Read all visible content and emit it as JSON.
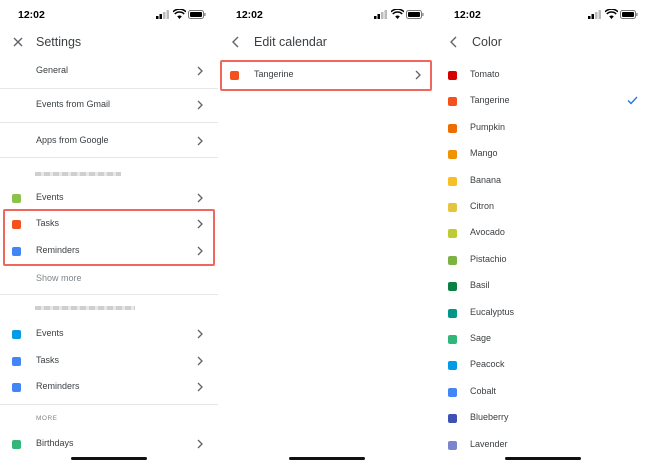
{
  "status_bar": {
    "time": "12:02"
  },
  "settings": {
    "title": "Settings",
    "top_items": [
      {
        "label": "General"
      },
      {
        "label": "Events from Gmail"
      },
      {
        "label": "Apps from Google"
      }
    ],
    "account1_items": [
      {
        "label": "Events",
        "color": "#8bc34a"
      },
      {
        "label": "Tasks",
        "color": "#f4511e"
      },
      {
        "label": "Reminders",
        "color": "#4285f4"
      }
    ],
    "show_more": "Show more",
    "account2_items": [
      {
        "label": "Events",
        "color": "#039be5"
      },
      {
        "label": "Tasks",
        "color": "#4285f4"
      },
      {
        "label": "Reminders",
        "color": "#4285f4"
      }
    ],
    "more_header": "MORE",
    "more_items": [
      {
        "label": "Birthdays",
        "color": "#33b679"
      }
    ]
  },
  "edit_calendar": {
    "title": "Edit calendar",
    "item": {
      "label": "Tangerine",
      "color": "#f4511e"
    }
  },
  "color": {
    "title": "Color",
    "selected": "Tangerine",
    "options": [
      {
        "label": "Tomato",
        "color": "#d50000"
      },
      {
        "label": "Tangerine",
        "color": "#f4511e"
      },
      {
        "label": "Pumpkin",
        "color": "#ef6c00"
      },
      {
        "label": "Mango",
        "color": "#f09300"
      },
      {
        "label": "Banana",
        "color": "#f6bf26"
      },
      {
        "label": "Citron",
        "color": "#e4c441"
      },
      {
        "label": "Avocado",
        "color": "#c0ca33"
      },
      {
        "label": "Pistachio",
        "color": "#7cb342"
      },
      {
        "label": "Basil",
        "color": "#0b8043"
      },
      {
        "label": "Eucalyptus",
        "color": "#009688"
      },
      {
        "label": "Sage",
        "color": "#33b679"
      },
      {
        "label": "Peacock",
        "color": "#039be5"
      },
      {
        "label": "Cobalt",
        "color": "#4285f4"
      },
      {
        "label": "Blueberry",
        "color": "#3f51b5"
      },
      {
        "label": "Lavender",
        "color": "#7986cb"
      }
    ]
  },
  "colors": {
    "highlight": "#f0675d",
    "check": "#1a73e8"
  }
}
